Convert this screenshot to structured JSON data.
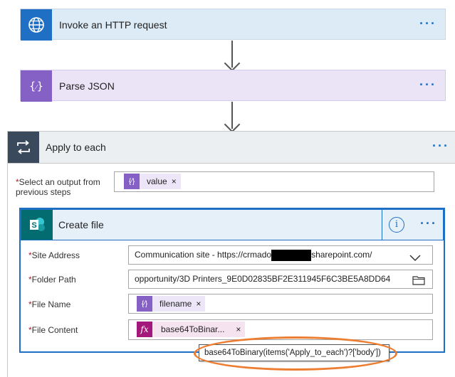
{
  "flow": {
    "http_action": {
      "title": "Invoke an HTTP request",
      "more": "···",
      "icon": "globe-icon",
      "accent": "#1f6fc5"
    },
    "parse_action": {
      "title": "Parse JSON",
      "more": "···",
      "icon": "code-braces-icon",
      "accent": "#8661c5"
    },
    "apply_each": {
      "title": "Apply to each",
      "more": "···",
      "icon": "loop-arrows-icon",
      "accent": "#3a4a5c",
      "output_label": "Select an output from previous steps",
      "output_token": "value"
    },
    "create_file": {
      "title": "Create file",
      "info": "i",
      "more": "···",
      "icon": "sharepoint-icon",
      "accent": "#036c70",
      "fields": {
        "site_address": {
          "label": "Site Address",
          "value_prefix": "Communication site - https://crmado",
          "value_suffix": "sharepoint.com/"
        },
        "folder_path": {
          "label": "Folder Path",
          "value": "opportunity/3D Printers_9E0D02835BF2E311945F6C3BE5A8DD64"
        },
        "file_name": {
          "label": "File Name",
          "token": "filename"
        },
        "file_content": {
          "label": "File Content",
          "token": "base64ToBinar..."
        }
      },
      "tooltip": "base64ToBinary(items('Apply_to_each')?['body'])"
    },
    "required_mark": "*",
    "close_glyph": "×",
    "fx_glyph": "fx",
    "colors": {
      "expression_token": "#f6e3f0",
      "expression_icon": "#a3187a",
      "dynamic_token": "#ece6f8",
      "dynamic_icon": "#8661c5",
      "highlight": "#ed7d31"
    }
  }
}
